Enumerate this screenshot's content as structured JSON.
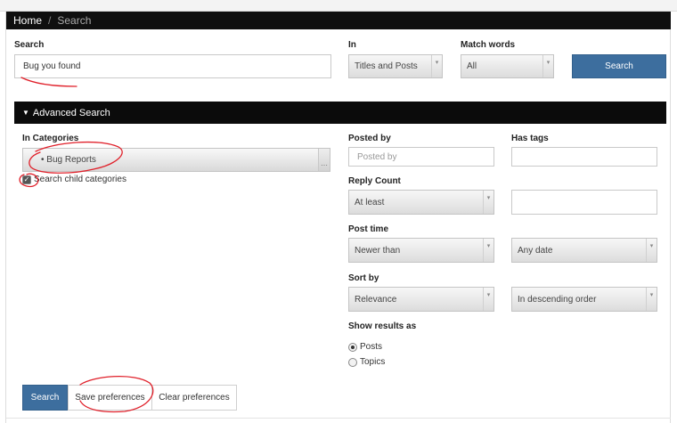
{
  "breadcrumb": {
    "home": "Home",
    "separator": "/",
    "current": "Search"
  },
  "search": {
    "label": "Search",
    "value": "Bug you found",
    "in_label": "In",
    "in_value": "Titles and Posts",
    "match_label": "Match words",
    "match_value": "All",
    "button": "Search"
  },
  "advanced": {
    "title": "Advanced Search",
    "in_categories_label": "In Categories",
    "category_value": "• Bug Reports",
    "child_categories_label": "Search child categories",
    "posted_by_label": "Posted by",
    "posted_by_placeholder": "Posted by",
    "has_tags_label": "Has tags",
    "reply_count_label": "Reply Count",
    "reply_count_value": "At least",
    "post_time_label": "Post time",
    "post_time_value": "Newer than",
    "post_date_value": "Any date",
    "sort_by_label": "Sort by",
    "sort_by_value": "Relevance",
    "sort_order_value": "In descending order",
    "show_results_label": "Show results as",
    "result_options": [
      "Posts",
      "Topics"
    ],
    "selected_result": "Posts"
  },
  "actions": {
    "search": "Search",
    "save": "Save preferences",
    "clear": "Clear preferences"
  },
  "colors": {
    "primary_button": "#3d6e9e",
    "header_bar": "#0b0b0b",
    "annotation": "#e0202a"
  },
  "icons": {
    "dropdown": "chevron-down-icon",
    "collapse": "triangle-down-icon",
    "check": "checkmark-icon"
  }
}
